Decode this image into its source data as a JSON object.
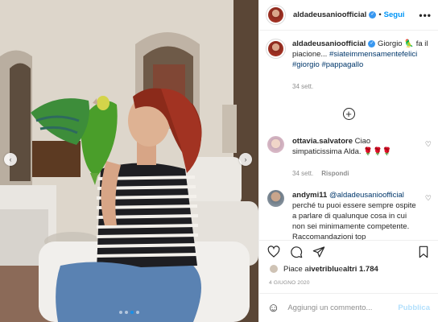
{
  "post": {
    "username": "aldadeusanioofficial",
    "follow_label": "Segui",
    "more_label": "•••",
    "separator": "•",
    "verified_glyph": "✓"
  },
  "caption": {
    "username": "aldadeusanioofficial",
    "text_before": " Giorgio ",
    "parrot_emoji": "🦜",
    "text_after": " fa il piacione... ",
    "hashtag1": "#siateimmensamentefelici",
    "hashtag2": "#giorgio",
    "hashtag3": "#pappagallo",
    "time": "34 sett."
  },
  "load_more_label": "+",
  "comments": [
    {
      "username": "ottavia.salvatore",
      "text": " Ciao simpaticissima Alda. ",
      "emoji": "🌹🌹🌹",
      "time": "34 sett.",
      "reply_label": "Rispondi"
    },
    {
      "username": "andymi11",
      "mention": "@aldadeusanioofficial",
      "text": " perché tu puoi essere sempre ospite a parlare di qualunque cosa in cui non sei minimamente competente. Raccomandazioni top"
    }
  ],
  "likes": {
    "prefix": "Piace a ",
    "user": "ivetriblu",
    "middle": " e ",
    "count": "altri 1.784"
  },
  "date": "4 GIUGNO 2020",
  "add_comment": {
    "placeholder": "Aggiungi un commento...",
    "publish_label": "Pubblica",
    "emoji_glyph": "☺"
  },
  "carousel": {
    "prev": "‹",
    "next": "›",
    "dots": 4,
    "active": 2
  },
  "colors": {
    "accent": "#0095f6",
    "parrot": "#4a9e2a",
    "hair": "#8b2a1a"
  }
}
